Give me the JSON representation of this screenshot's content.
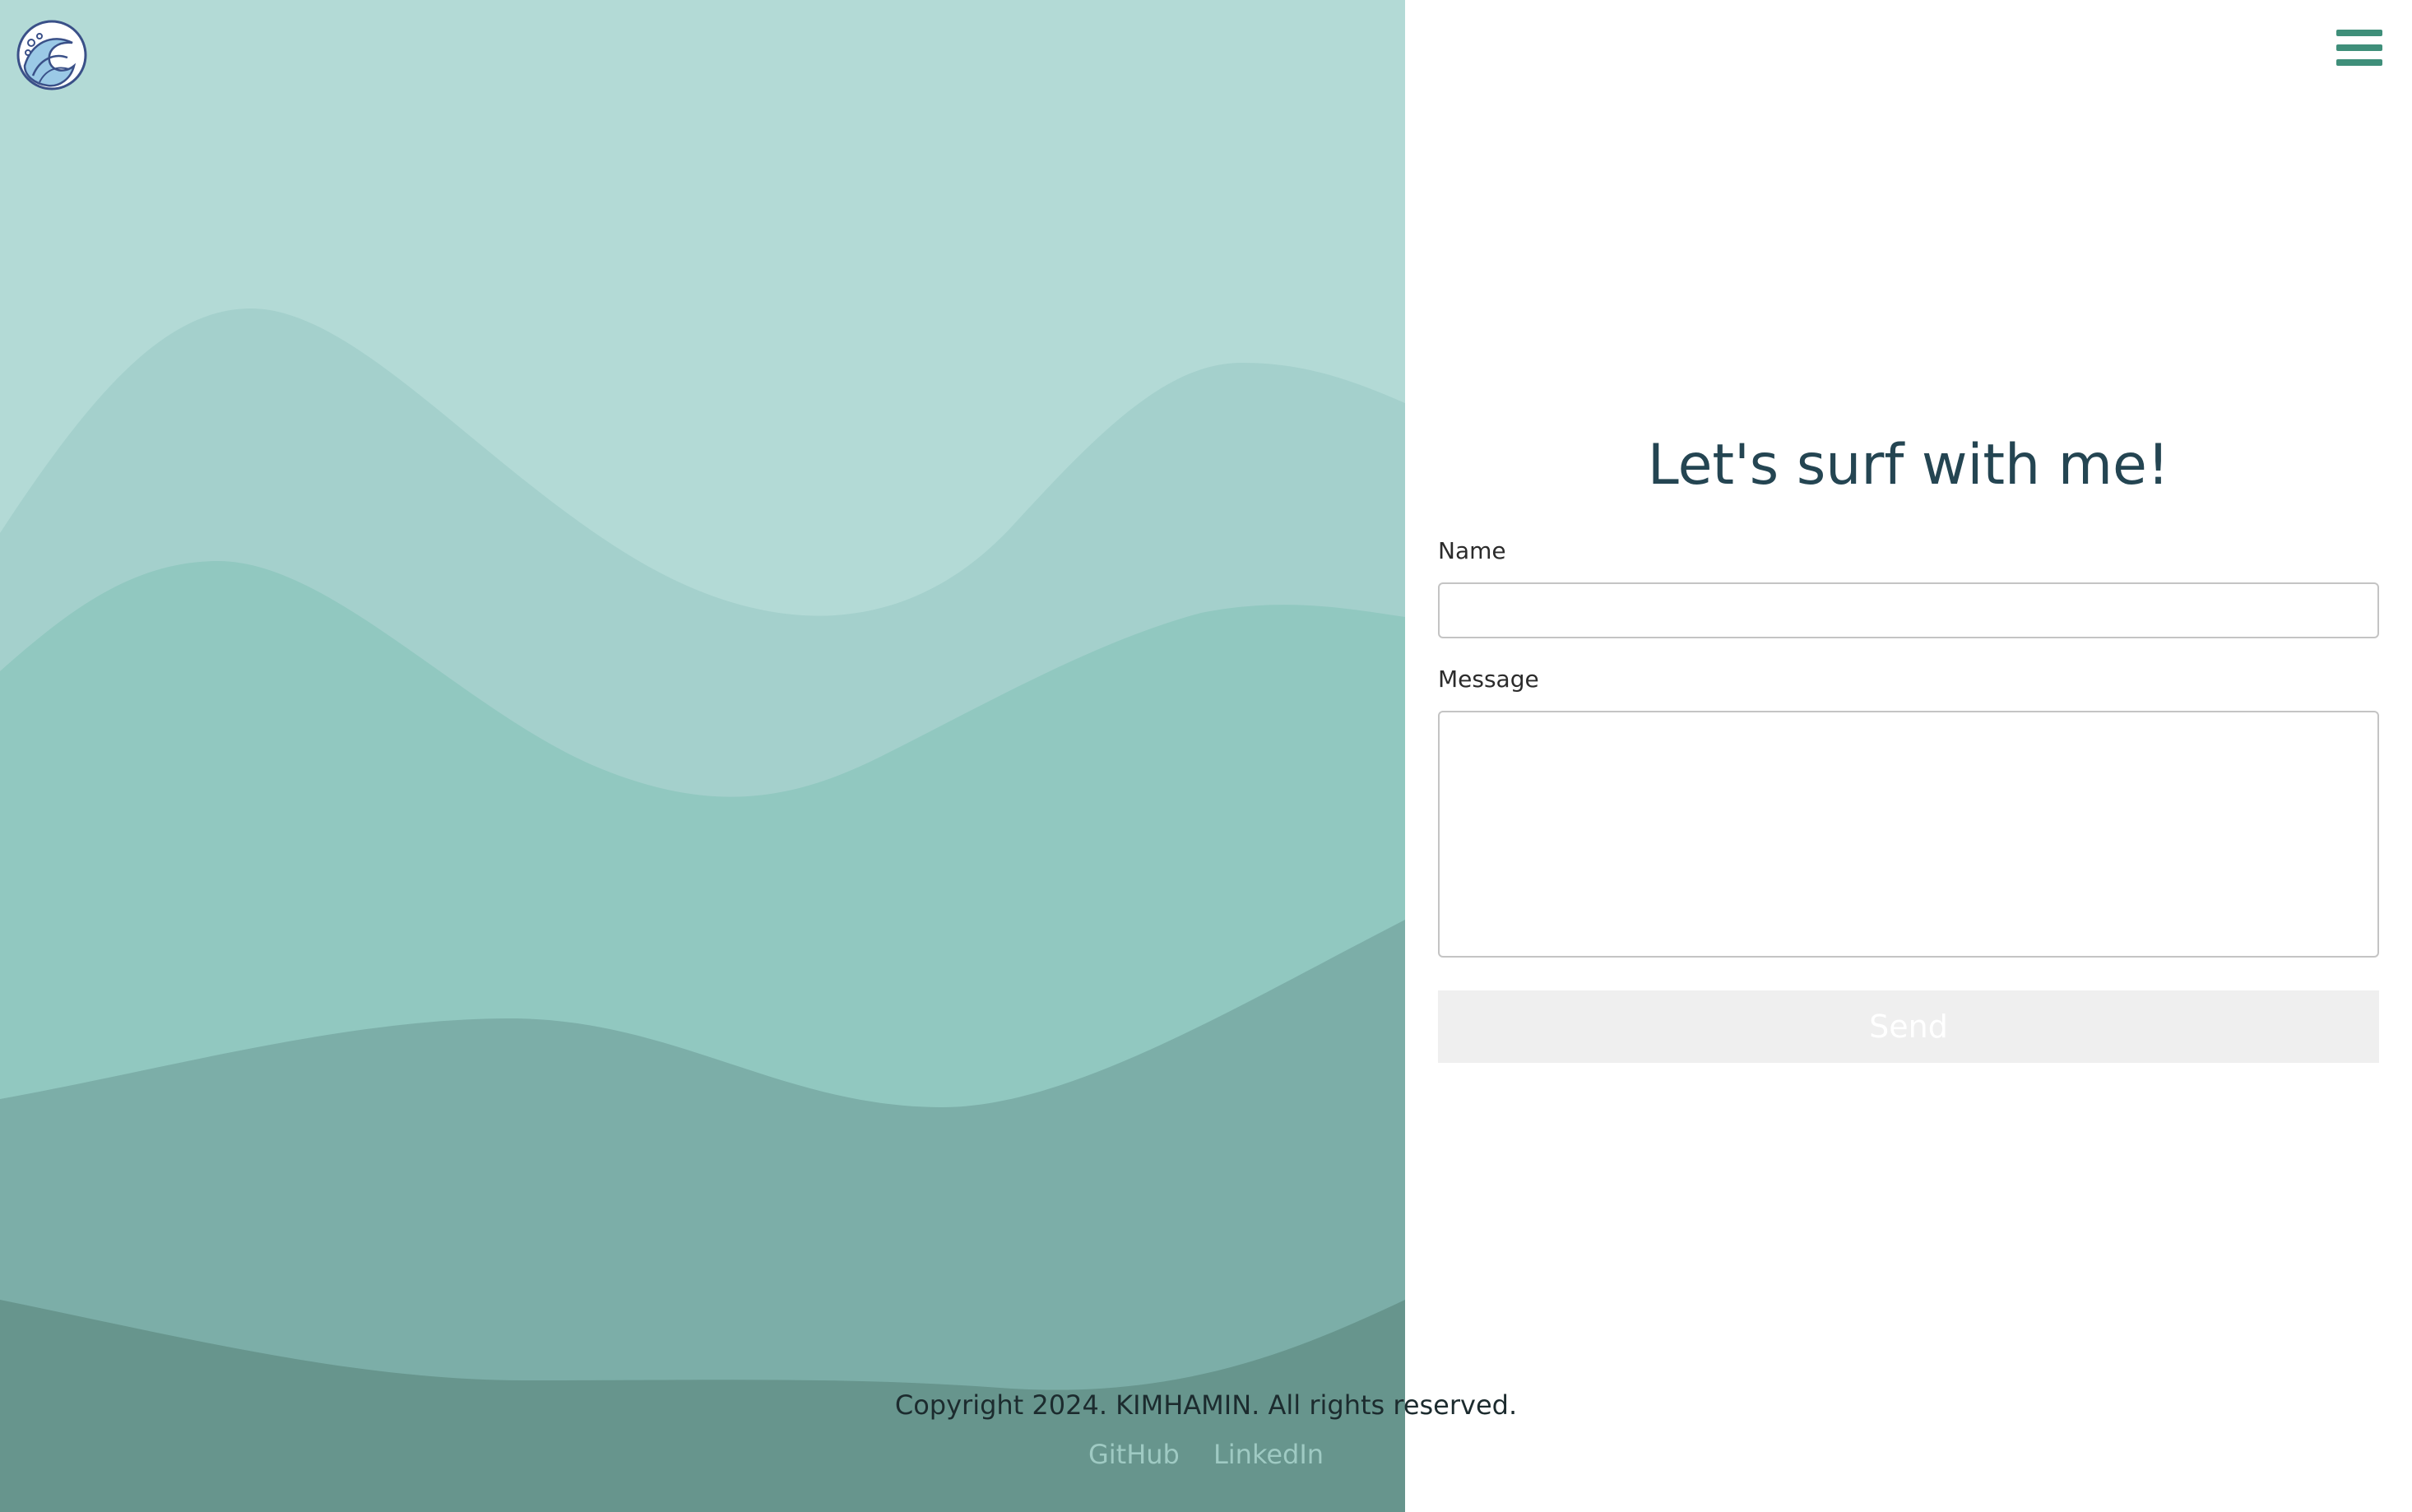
{
  "header": {
    "logo_icon": "wave-logo-icon",
    "menu_icon": "hamburger-menu-icon"
  },
  "contact": {
    "title": "Let's surf with me!",
    "name_label": "Name",
    "name_value": "",
    "message_label": "Message",
    "message_value": "",
    "send_label": "Send"
  },
  "footer": {
    "copyright": "Copyright 2024. KIMHAMIN. All rights reserved.",
    "links": [
      "GitHub",
      "LinkedIn"
    ]
  },
  "colors": {
    "wave_1": "#b3dad6",
    "wave_2": "#a4d0cc",
    "wave_3": "#91c8c0",
    "wave_4": "#7caea8",
    "wave_5": "#67958d",
    "accent": "#3f8f7a",
    "title": "#244552",
    "send_button_bg": "#efefef"
  }
}
